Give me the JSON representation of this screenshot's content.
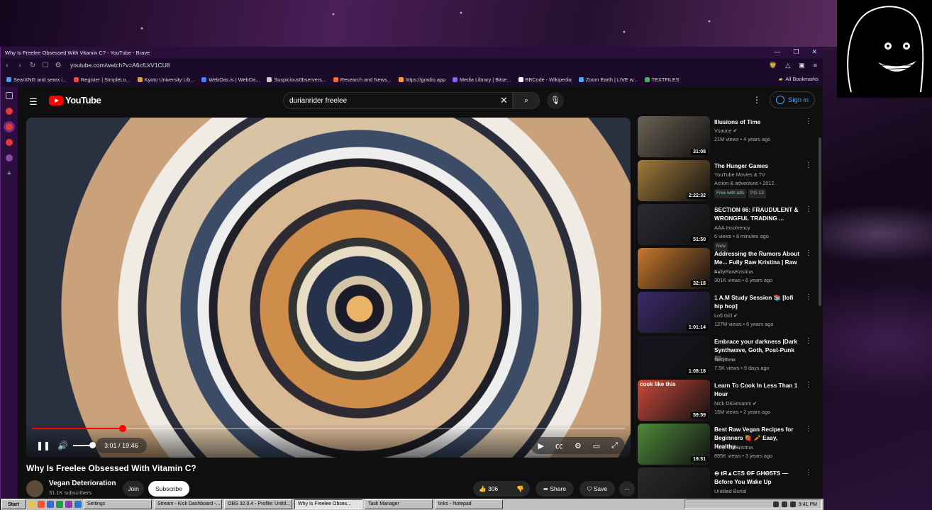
{
  "window": {
    "title": "Why Is Freelee Obsessed With Vitamin C? - YouTube - Brave"
  },
  "addressbar": {
    "url": "youtube.com/watch?v=A6cfLkV1CU8"
  },
  "bookmarks": [
    {
      "label": "SearXNG and searx i...",
      "color": "#3aa0ff"
    },
    {
      "label": "Register | SimpleLo...",
      "color": "#e34a4a"
    },
    {
      "label": "Kyoto University Lib...",
      "color": "#d9a441"
    },
    {
      "label": "WebOas.is | WebOa...",
      "color": "#4a7dff"
    },
    {
      "label": "Suspicious0bservers...",
      "color": "#cccccc"
    },
    {
      "label": "Research and News...",
      "color": "#ff6a2a"
    },
    {
      "label": "https://gradio.app",
      "color": "#ff9a3c"
    },
    {
      "label": "Media Library | Bitse...",
      "color": "#8a5cff"
    },
    {
      "label": "BBCode - Wikipedia",
      "color": "#ffffff"
    },
    {
      "label": "Zoom Earth | LIVE w...",
      "color": "#3fa9f5"
    },
    {
      "label": "TEXTFILES",
      "color": "#2fbf4a"
    }
  ],
  "bookmarks_all": "All Bookmarks",
  "youtube": {
    "logo": "YouTube",
    "search_value": "durianrider freelee",
    "sign_in": "Sign in"
  },
  "player": {
    "current_time": "3:01",
    "separator": "/",
    "duration": "19:46",
    "progress_fraction": 0.153,
    "volume_fraction": 1.0
  },
  "video": {
    "title": "Why Is Freelee Obsessed With Vitamin C?",
    "channel": "Vegan Deterioration",
    "subscribers": "31.1K subscribers",
    "join": "Join",
    "subscribe": "Subscribe",
    "likes": "306",
    "share": "Share",
    "save": "Save"
  },
  "recommendations": [
    {
      "title": "Illusions of Time",
      "channel": "Vsauce",
      "meta": "21M views • 4 years ago",
      "duration": "31:08",
      "thumb": "#6b6255",
      "verified": true
    },
    {
      "title": "The Hunger Games",
      "channel": "YouTube Movies & TV",
      "meta": "Action & adventure • 2012",
      "duration": "2:22:32",
      "thumb": "#a27a3c",
      "badges": [
        "Free with ads",
        "PG-13"
      ]
    },
    {
      "title": "SECTION 66: FRAUDULENT & WRONGFUL TRADING ...",
      "channel": "AAA Insolvency",
      "meta": "6 views • 8 minutes ago",
      "duration": "51:50",
      "thumb": "#2a2a33",
      "badges": [
        "New"
      ]
    },
    {
      "title": "Addressing the Rumors About Me... Fully Raw Kristina | Raw ...",
      "channel": "FullyRawKristina",
      "meta": "301K views • 6 years ago",
      "duration": "32:18",
      "thumb": "#c9782e"
    },
    {
      "title": "1 A.M Study Session 📚 [lofi hip hop]",
      "channel": "Lofi Girl",
      "meta": "127M views • 6 years ago",
      "duration": "1:01:14",
      "thumb": "#3a2a6a",
      "verified": true
    },
    {
      "title": "Embrace your darkness |Dark Synthwave, Goth, Post-Punk 🖤",
      "channel": "𝕲𝖔𝖙𝖍𝕰𝖊𝖓𝖆",
      "meta": "7.5K views • 9 days ago",
      "duration": "1:08:18",
      "thumb": "#151520"
    },
    {
      "title": "Learn To Cook In Less Than 1 Hour",
      "channel": "Nick DiGiovanni",
      "meta": "16M views • 2 years ago",
      "duration": "59:59",
      "thumb": "#c94a3a",
      "verified": true,
      "overlay": "cook like this"
    },
    {
      "title": "Best Raw Vegan Recipes for Beginners 🍓 🥕 Easy, Healthy...",
      "channel": "FullyRawKristina",
      "meta": "895K views • 3 years ago",
      "duration": "19:51",
      "thumb": "#4e8a3a"
    },
    {
      "title": "⊖ ŧЯ▲CΞS ΘF GHΘ5ŦS — Before You Wake Up",
      "channel": "Untitled Burial",
      "meta": "",
      "duration": "",
      "thumb": "#2a2a2a"
    }
  ],
  "taskbar": {
    "start": "Start",
    "tasks": [
      "Settings",
      "Stream - Kick Dashboard -...",
      "OBS 32.0.4 - Profile: Untitl...",
      "Why Is Freelee Obses...",
      "Task Manager",
      "links - Notepad"
    ],
    "active_task": 3,
    "clock": "9:41 PM"
  }
}
